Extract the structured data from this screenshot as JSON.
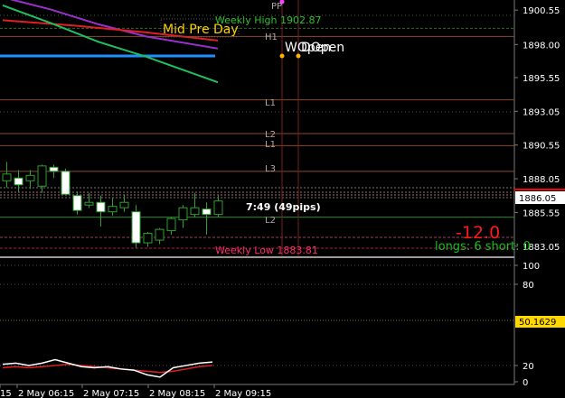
{
  "colors": {
    "background": "#000000",
    "grid_dotted": "#3a4a3a",
    "level_line": "#8b4a2a",
    "cyan_line": "#1f8fff",
    "purple_line": "#9b30d0",
    "red_line": "#e02020",
    "green_line": "#20c060",
    "candle_bull": "#000000",
    "candle_bear": "#ffffff",
    "wick": "#2ea02e",
    "price_box_bg": "#ffffff",
    "stoch_box_bg": "#ffd800"
  },
  "main_panel": {
    "price_ticks": [
      "1900.55",
      "1898.00",
      "1895.55",
      "1893.05",
      "1890.55",
      "1888.05",
      "1885.55",
      "1883.05"
    ],
    "current_price": "1886.05",
    "labels": {
      "mid_pre_day": "Mid Pre Day",
      "weekly_high": "Weekly High 1902.87",
      "weekly_low": "Weekly Low 1883.81",
      "w_open": "WOpen",
      "d_open": "DOpen",
      "h1": "H1",
      "l1_upper": "L1",
      "l2": "L2",
      "l1": "L1",
      "l3": "L3",
      "l2_lower": "L2",
      "pp": "PP",
      "timer": "7:49 (49pips)",
      "pips_value": "-12.0",
      "long_short": "longs: 6  short: 0"
    }
  },
  "sub_panel": {
    "ticks": [
      "100",
      "80",
      "50.1629",
      "20",
      "0"
    ],
    "stoch_value": "50.1629"
  },
  "time_axis": {
    "labels": [
      "15",
      "2 May 06:15",
      "2 May 07:15",
      "2 May 08:15",
      "2 May 09:15"
    ]
  },
  "chart_data": {
    "type": "candlestick",
    "title": "",
    "y_axis_range": [
      1882.3,
      1901.3
    ],
    "y_scale": "linear",
    "grid": true,
    "levels": [
      {
        "name": "Weekly High",
        "value": 1899.2
      },
      {
        "name": "H1",
        "value": 1898.6
      },
      {
        "name": "L1",
        "value": 1893.9
      },
      {
        "name": "L2",
        "value": 1891.4
      },
      {
        "name": "L1",
        "value": 1890.5
      },
      {
        "name": "L3",
        "value": 1888.6
      },
      {
        "name": "L2",
        "value": 1885.2
      },
      {
        "name": "Weekly Low",
        "value": 1882.9
      }
    ],
    "candles": [
      {
        "open": 1887.9,
        "high": 1889.3,
        "low": 1887.4,
        "close": 1888.4
      },
      {
        "open": 1888.1,
        "high": 1888.7,
        "low": 1887.1,
        "close": 1887.6
      },
      {
        "open": 1887.9,
        "high": 1888.7,
        "low": 1887.3,
        "close": 1888.3
      },
      {
        "open": 1887.5,
        "high": 1889.1,
        "low": 1887.0,
        "close": 1889.0
      },
      {
        "open": 1888.9,
        "high": 1889.1,
        "low": 1888.1,
        "close": 1888.6
      },
      {
        "open": 1888.6,
        "high": 1888.8,
        "low": 1886.8,
        "close": 1886.9
      },
      {
        "open": 1886.8,
        "high": 1887.1,
        "low": 1885.4,
        "close": 1885.7
      },
      {
        "open": 1886.1,
        "high": 1887.0,
        "low": 1885.9,
        "close": 1886.3
      },
      {
        "open": 1886.3,
        "high": 1886.8,
        "low": 1884.5,
        "close": 1885.6
      },
      {
        "open": 1885.6,
        "high": 1886.6,
        "low": 1885.3,
        "close": 1886.0
      },
      {
        "open": 1885.9,
        "high": 1886.9,
        "low": 1885.6,
        "close": 1886.3
      },
      {
        "open": 1885.6,
        "high": 1886.1,
        "low": 1882.9,
        "close": 1883.3
      },
      {
        "open": 1883.3,
        "high": 1884.1,
        "low": 1883.0,
        "close": 1884.0
      },
      {
        "open": 1883.5,
        "high": 1884.4,
        "low": 1883.2,
        "close": 1884.3
      },
      {
        "open": 1884.2,
        "high": 1885.2,
        "low": 1883.9,
        "close": 1885.1
      },
      {
        "open": 1885.0,
        "high": 1886.1,
        "low": 1884.4,
        "close": 1885.9
      },
      {
        "open": 1885.4,
        "high": 1887.0,
        "low": 1885.2,
        "close": 1885.9
      },
      {
        "open": 1885.8,
        "high": 1886.3,
        "low": 1883.9,
        "close": 1885.4
      },
      {
        "open": 1885.4,
        "high": 1886.8,
        "low": 1885.2,
        "close": 1886.4
      }
    ],
    "ma_lines": [
      {
        "color_key": "purple_line",
        "points": [
          [
            0,
            1901.5
          ],
          [
            2,
            1900.6
          ],
          [
            4,
            1899.5
          ],
          [
            6,
            1898.6
          ],
          [
            9,
            1897.7
          ]
        ]
      },
      {
        "color_key": "red_line",
        "points": [
          [
            0,
            1899.8
          ],
          [
            3,
            1899.4
          ],
          [
            6,
            1898.9
          ],
          [
            9,
            1898.3
          ]
        ]
      },
      {
        "color_key": "green_line",
        "points": [
          [
            0,
            1900.9
          ],
          [
            2,
            1899.6
          ],
          [
            4,
            1898.2
          ],
          [
            6,
            1897.1
          ],
          [
            9,
            1895.2
          ]
        ]
      }
    ],
    "stoch_k": [
      15,
      16,
      14,
      16,
      19,
      16,
      13,
      12,
      13,
      11,
      10,
      6,
      4,
      12,
      14,
      16,
      17
    ],
    "stoch_d": [
      12,
      13,
      12,
      13,
      14,
      15,
      14,
      13,
      12,
      11,
      10,
      9,
      8,
      9,
      11,
      13,
      14
    ]
  }
}
